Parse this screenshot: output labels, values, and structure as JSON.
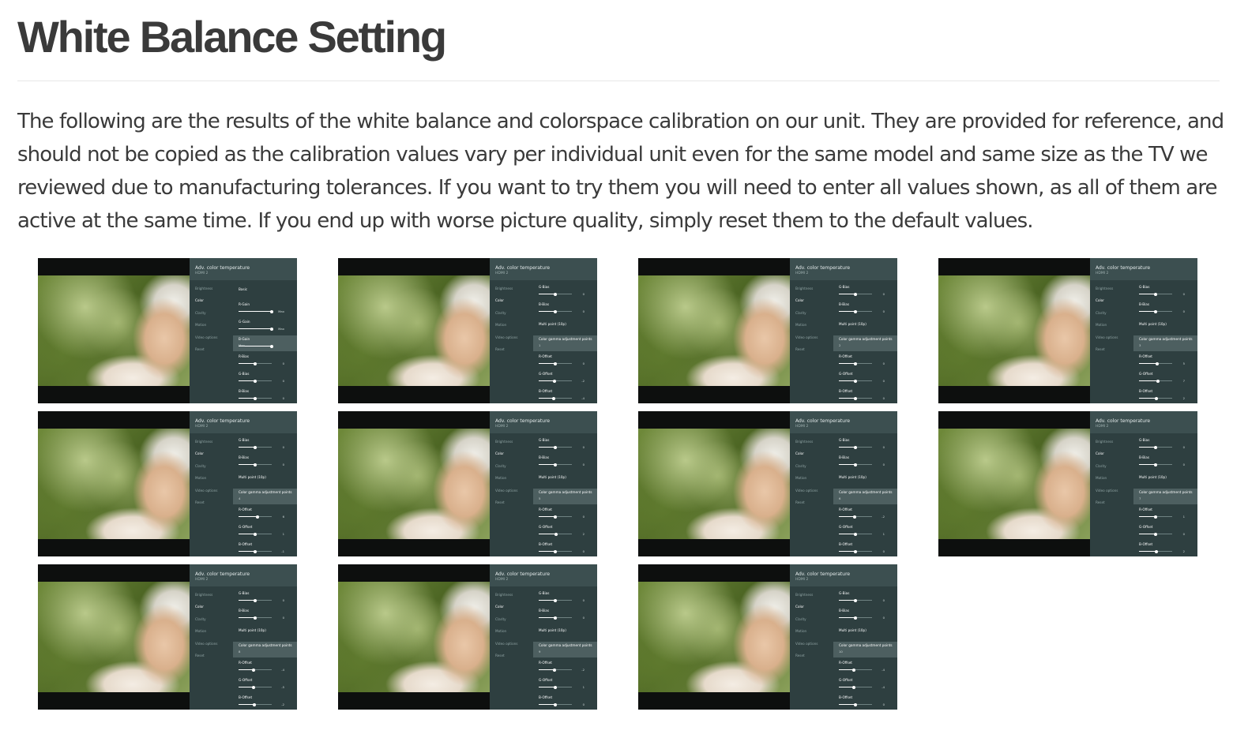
{
  "article": {
    "title": "White Balance Setting",
    "intro": "The following are the results of the white balance and colorspace calibration on our unit. They are provided for reference, and should not be copied as the calibration values vary per individual unit even for the same model and same size as the TV we reviewed due to manufacturing tolerances. If you want to try them you will need to enter all values shown, as all of them are active at the same time. If you end up with worse picture quality, simply reset them to the default values."
  },
  "tv_menu": {
    "title": "Adv. color temperature",
    "source": "HDMI 2",
    "side_menu": [
      "Brightness",
      "Color",
      "Clarity",
      "Motion",
      "Video options",
      "Reset"
    ],
    "active_item": "Color",
    "colors": {
      "panel": "#2e3f40",
      "header": "#3c4f50",
      "highlight": "#4d5f60"
    }
  },
  "screenshots": [
    {
      "rows": [
        {
          "type": "plain",
          "label": "Basic"
        },
        {
          "type": "slider",
          "label": "R-Gain",
          "value": "Max",
          "level": 1.0
        },
        {
          "type": "slider",
          "label": "G-Gain",
          "value": "Max",
          "level": 1.0
        },
        {
          "type": "slider",
          "label": "B-Gain",
          "value": "Max",
          "level": 1.0,
          "highlight": true
        },
        {
          "type": "slider",
          "label": "R-Bias",
          "value": "0",
          "level": 0.5
        },
        {
          "type": "slider",
          "label": "G-Bias",
          "value": "0",
          "level": 0.5
        },
        {
          "type": "slider",
          "label": "B-Bias",
          "value": "0",
          "level": 0.5
        }
      ]
    },
    {
      "rows": [
        {
          "type": "slider",
          "label": "G-Bias",
          "value": "0",
          "level": 0.5
        },
        {
          "type": "slider",
          "label": "B-Bias",
          "value": "0",
          "level": 0.5
        },
        {
          "type": "plain",
          "label": "Multi point (10p)"
        },
        {
          "type": "select",
          "label": "Color gamma adjustment points",
          "value": "1"
        },
        {
          "type": "slider",
          "label": "R-Offset",
          "value": "0",
          "level": 0.5
        },
        {
          "type": "slider",
          "label": "G-Offset",
          "value": "-2",
          "level": 0.48
        },
        {
          "type": "slider",
          "label": "B-Offset",
          "value": "-4",
          "level": 0.46
        }
      ]
    },
    {
      "rows": [
        {
          "type": "slider",
          "label": "G-Bias",
          "value": "0",
          "level": 0.5
        },
        {
          "type": "slider",
          "label": "B-Bias",
          "value": "0",
          "level": 0.5
        },
        {
          "type": "plain",
          "label": "Multi point (10p)"
        },
        {
          "type": "select",
          "label": "Color gamma adjustment points",
          "value": "2"
        },
        {
          "type": "slider",
          "label": "R-Offset",
          "value": "0",
          "level": 0.5
        },
        {
          "type": "slider",
          "label": "G-Offset",
          "value": "0",
          "level": 0.5
        },
        {
          "type": "slider",
          "label": "B-Offset",
          "value": "0",
          "level": 0.5
        }
      ]
    },
    {
      "rows": [
        {
          "type": "slider",
          "label": "G-Bias",
          "value": "0",
          "level": 0.5
        },
        {
          "type": "slider",
          "label": "B-Bias",
          "value": "0",
          "level": 0.5
        },
        {
          "type": "plain",
          "label": "Multi point (10p)"
        },
        {
          "type": "select",
          "label": "Color gamma adjustment points",
          "value": "3"
        },
        {
          "type": "slider",
          "label": "R-Offset",
          "value": "5",
          "level": 0.55
        },
        {
          "type": "slider",
          "label": "G-Offset",
          "value": "7",
          "level": 0.57
        },
        {
          "type": "slider",
          "label": "B-Offset",
          "value": "2",
          "level": 0.52
        }
      ]
    },
    {
      "rows": [
        {
          "type": "slider",
          "label": "G-Bias",
          "value": "0",
          "level": 0.5
        },
        {
          "type": "slider",
          "label": "B-Bias",
          "value": "0",
          "level": 0.5
        },
        {
          "type": "plain",
          "label": "Multi point (10p)"
        },
        {
          "type": "select",
          "label": "Color gamma adjustment points",
          "value": "4"
        },
        {
          "type": "slider",
          "label": "R-Offset",
          "value": "6",
          "level": 0.56
        },
        {
          "type": "slider",
          "label": "G-Offset",
          "value": "1",
          "level": 0.51
        },
        {
          "type": "slider",
          "label": "B-Offset",
          "value": "-1",
          "level": 0.49
        }
      ]
    },
    {
      "rows": [
        {
          "type": "slider",
          "label": "G-Bias",
          "value": "0",
          "level": 0.5
        },
        {
          "type": "slider",
          "label": "B-Bias",
          "value": "0",
          "level": 0.5
        },
        {
          "type": "plain",
          "label": "Multi point (10p)"
        },
        {
          "type": "select",
          "label": "Color gamma adjustment points",
          "value": "5"
        },
        {
          "type": "slider",
          "label": "R-Offset",
          "value": "0",
          "level": 0.5
        },
        {
          "type": "slider",
          "label": "G-Offset",
          "value": "2",
          "level": 0.52
        },
        {
          "type": "slider",
          "label": "B-Offset",
          "value": "0",
          "level": 0.5
        }
      ]
    },
    {
      "rows": [
        {
          "type": "slider",
          "label": "G-Bias",
          "value": "0",
          "level": 0.5
        },
        {
          "type": "slider",
          "label": "B-Bias",
          "value": "0",
          "level": 0.5
        },
        {
          "type": "plain",
          "label": "Multi point (10p)"
        },
        {
          "type": "select",
          "label": "Color gamma adjustment points",
          "value": "6"
        },
        {
          "type": "slider",
          "label": "R-Offset",
          "value": "-2",
          "level": 0.48
        },
        {
          "type": "slider",
          "label": "G-Offset",
          "value": "1",
          "level": 0.51
        },
        {
          "type": "slider",
          "label": "B-Offset",
          "value": "0",
          "level": 0.5
        }
      ]
    },
    {
      "rows": [
        {
          "type": "slider",
          "label": "G-Bias",
          "value": "0",
          "level": 0.5
        },
        {
          "type": "slider",
          "label": "B-Bias",
          "value": "0",
          "level": 0.5
        },
        {
          "type": "plain",
          "label": "Multi point (10p)"
        },
        {
          "type": "select",
          "label": "Color gamma adjustment points",
          "value": "7"
        },
        {
          "type": "slider",
          "label": "R-Offset",
          "value": "1",
          "level": 0.51
        },
        {
          "type": "slider",
          "label": "G-Offset",
          "value": "0",
          "level": 0.5
        },
        {
          "type": "slider",
          "label": "B-Offset",
          "value": "2",
          "level": 0.52
        }
      ]
    },
    {
      "rows": [
        {
          "type": "slider",
          "label": "G-Bias",
          "value": "0",
          "level": 0.5
        },
        {
          "type": "slider",
          "label": "B-Bias",
          "value": "0",
          "level": 0.5
        },
        {
          "type": "plain",
          "label": "Multi point (10p)"
        },
        {
          "type": "select",
          "label": "Color gamma adjustment points",
          "value": "8"
        },
        {
          "type": "slider",
          "label": "R-Offset",
          "value": "-4",
          "level": 0.46
        },
        {
          "type": "slider",
          "label": "G-Offset",
          "value": "-5",
          "level": 0.45
        },
        {
          "type": "slider",
          "label": "B-Offset",
          "value": "-2",
          "level": 0.48
        }
      ]
    },
    {
      "rows": [
        {
          "type": "slider",
          "label": "G-Bias",
          "value": "0",
          "level": 0.5
        },
        {
          "type": "slider",
          "label": "B-Bias",
          "value": "0",
          "level": 0.5
        },
        {
          "type": "plain",
          "label": "Multi point (10p)"
        },
        {
          "type": "select",
          "label": "Color gamma adjustment points",
          "value": "9"
        },
        {
          "type": "slider",
          "label": "R-Offset",
          "value": "-2",
          "level": 0.48
        },
        {
          "type": "slider",
          "label": "G-Offset",
          "value": "1",
          "level": 0.51
        },
        {
          "type": "slider",
          "label": "B-Offset",
          "value": "0",
          "level": 0.5
        }
      ]
    },
    {
      "rows": [
        {
          "type": "slider",
          "label": "G-Bias",
          "value": "0",
          "level": 0.5
        },
        {
          "type": "slider",
          "label": "B-Bias",
          "value": "0",
          "level": 0.5
        },
        {
          "type": "plain",
          "label": "Multi point (10p)"
        },
        {
          "type": "select",
          "label": "Color gamma adjustment points",
          "value": "10"
        },
        {
          "type": "slider",
          "label": "R-Offset",
          "value": "-4",
          "level": 0.46
        },
        {
          "type": "slider",
          "label": "G-Offset",
          "value": "-4",
          "level": 0.46
        },
        {
          "type": "slider",
          "label": "B-Offset",
          "value": "0",
          "level": 0.5
        }
      ]
    }
  ]
}
